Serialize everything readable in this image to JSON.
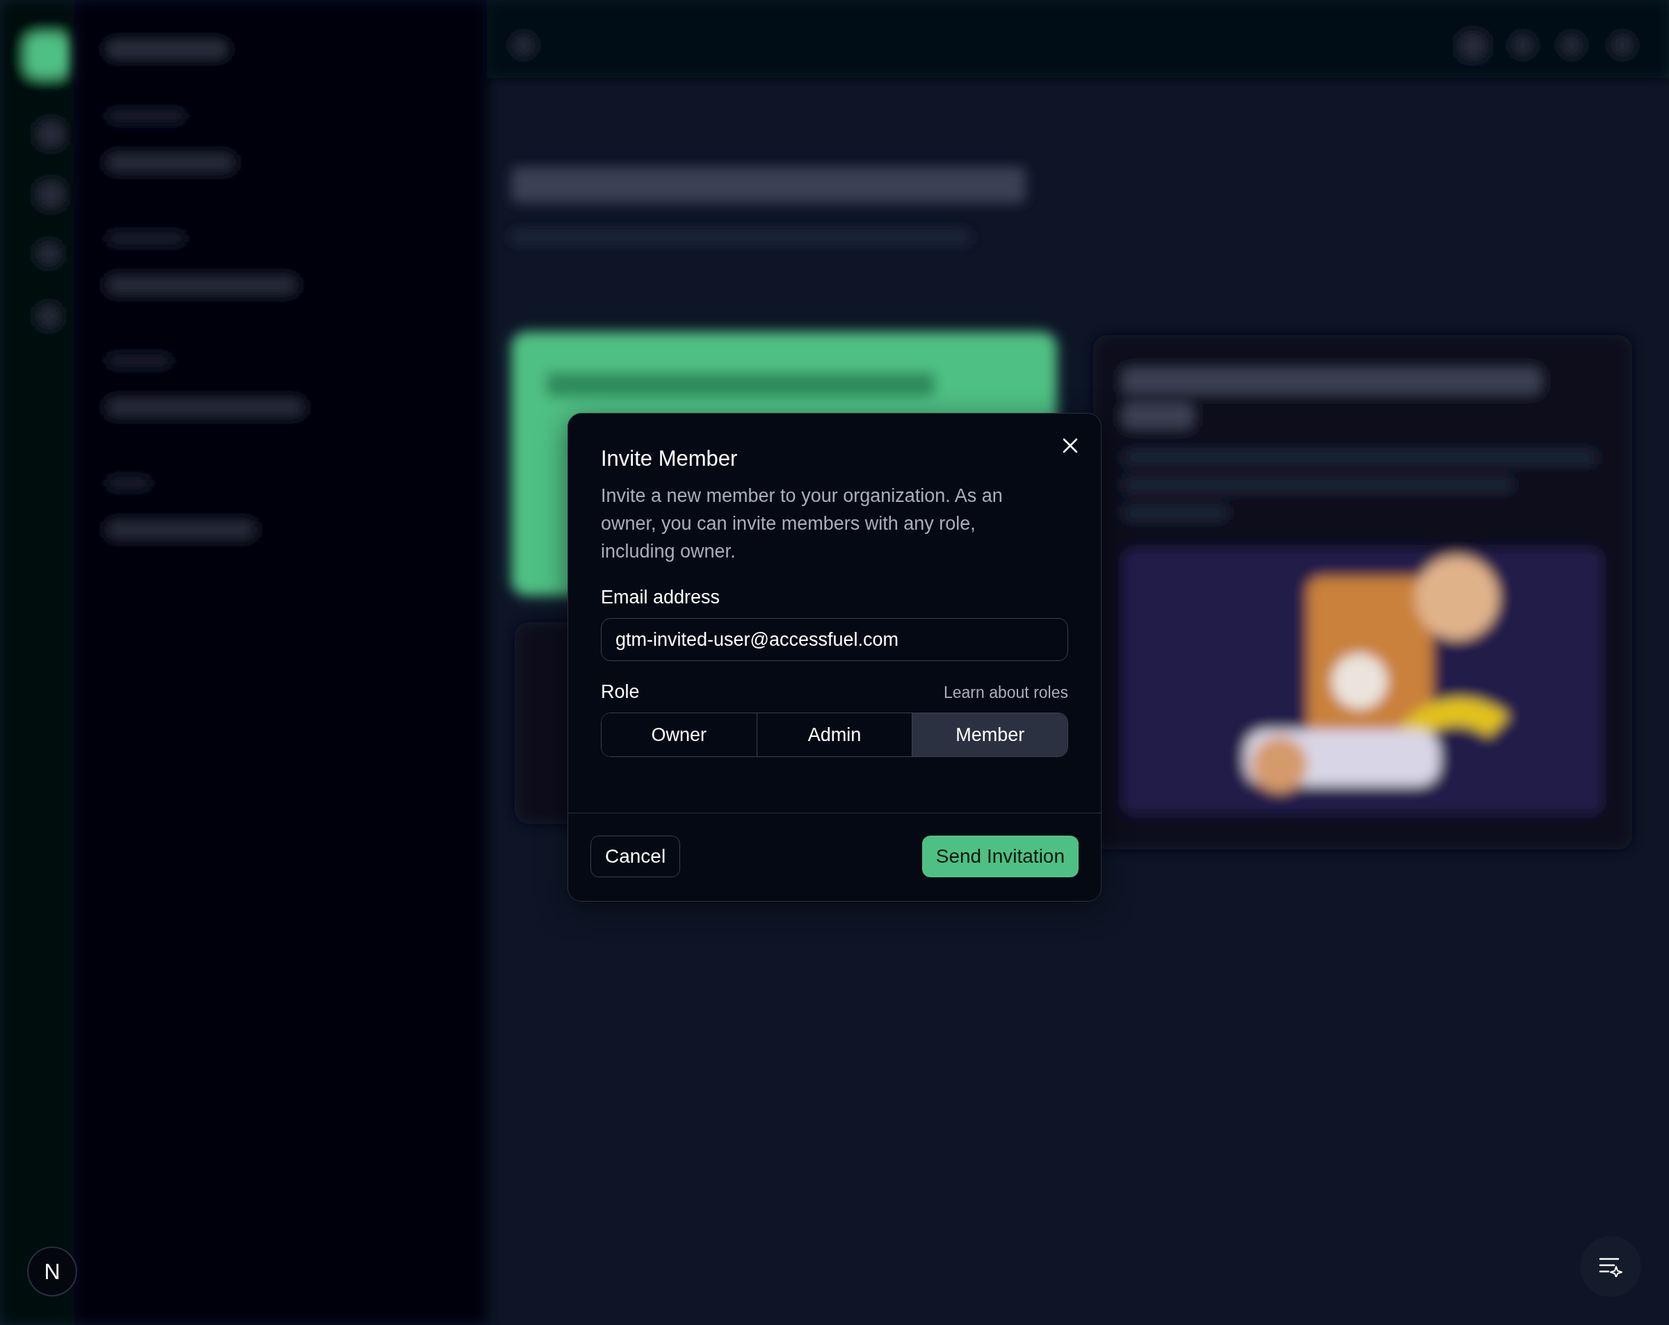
{
  "dialog": {
    "title": "Invite Member",
    "description": "Invite a new member to your organization. As an owner, you can invite members with any role, including owner.",
    "email": {
      "label": "Email address",
      "value": "gtm-invited-user@accessfuel.com"
    },
    "role": {
      "label": "Role",
      "link": "Learn about roles",
      "options": [
        {
          "label": "Owner",
          "selected": false
        },
        {
          "label": "Admin",
          "selected": false
        },
        {
          "label": "Member",
          "selected": true
        }
      ]
    },
    "buttons": [
      {
        "label": "Cancel",
        "kind": "secondary"
      },
      {
        "label": "Send Invitation",
        "kind": "primary"
      }
    ]
  },
  "user_avatar": {
    "initial": "N"
  }
}
